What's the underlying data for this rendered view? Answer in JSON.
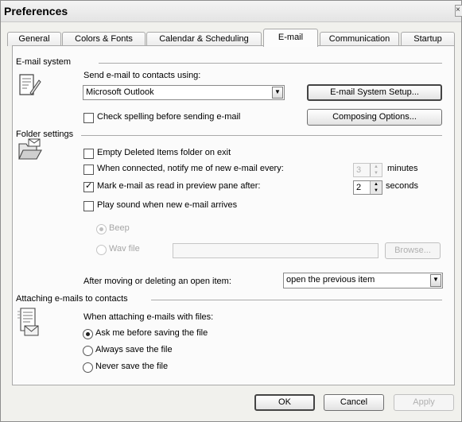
{
  "window": {
    "title": "Preferences",
    "close_glyph": "×"
  },
  "tabs": [
    {
      "label": "General"
    },
    {
      "label": "Colors & Fonts"
    },
    {
      "label": "Calendar & Scheduling"
    },
    {
      "label": "E-mail"
    },
    {
      "label": "Communication"
    },
    {
      "label": "Startup"
    }
  ],
  "active_tab": "E-mail",
  "email_system": {
    "section_label": "E-mail system",
    "send_label": "Send e-mail to contacts using:",
    "client_value": "Microsoft Outlook",
    "setup_button": "E-mail System Setup...",
    "spell_check_label": "Check spelling before sending e-mail",
    "spell_check_checked": false,
    "composing_button": "Composing Options...",
    "icon": "notepad-pen-icon"
  },
  "folder_settings": {
    "section_label": "Folder settings",
    "icon": "open-folder-envelope-icon",
    "empty_deleted_label": "Empty Deleted Items folder on exit",
    "empty_deleted_checked": false,
    "notify_label": "When connected, notify me of new e-mail every:",
    "notify_checked": false,
    "notify_value": "3",
    "notify_unit": "minutes",
    "mark_read_label": "Mark e-mail as read in preview pane after:",
    "mark_read_checked": true,
    "mark_read_value": "2",
    "mark_read_unit": "seconds",
    "play_sound_label": "Play sound when new e-mail arrives",
    "play_sound_checked": false,
    "beep_label": "Beep",
    "wav_label": "Wav file",
    "wav_value": "",
    "browse_button": "Browse...",
    "after_moving_label": "After moving or deleting an open item:",
    "after_moving_value": "open the previous item"
  },
  "attaching": {
    "section_label": "Attaching e-mails to contacts",
    "icon": "document-envelope-icon",
    "when_label": "When attaching e-mails with files:",
    "options": [
      {
        "label": "Ask me before saving the file",
        "selected": true
      },
      {
        "label": "Always save the file",
        "selected": false
      },
      {
        "label": "Never save the file",
        "selected": false
      }
    ]
  },
  "footer": {
    "ok": "OK",
    "cancel": "Cancel",
    "apply": "Apply"
  },
  "colors": {
    "window_bg": "#f1f1ed",
    "panel_bg": "#fbfbfb",
    "border": "#a8a8a8",
    "disabled_text": "#a6a6a6"
  }
}
